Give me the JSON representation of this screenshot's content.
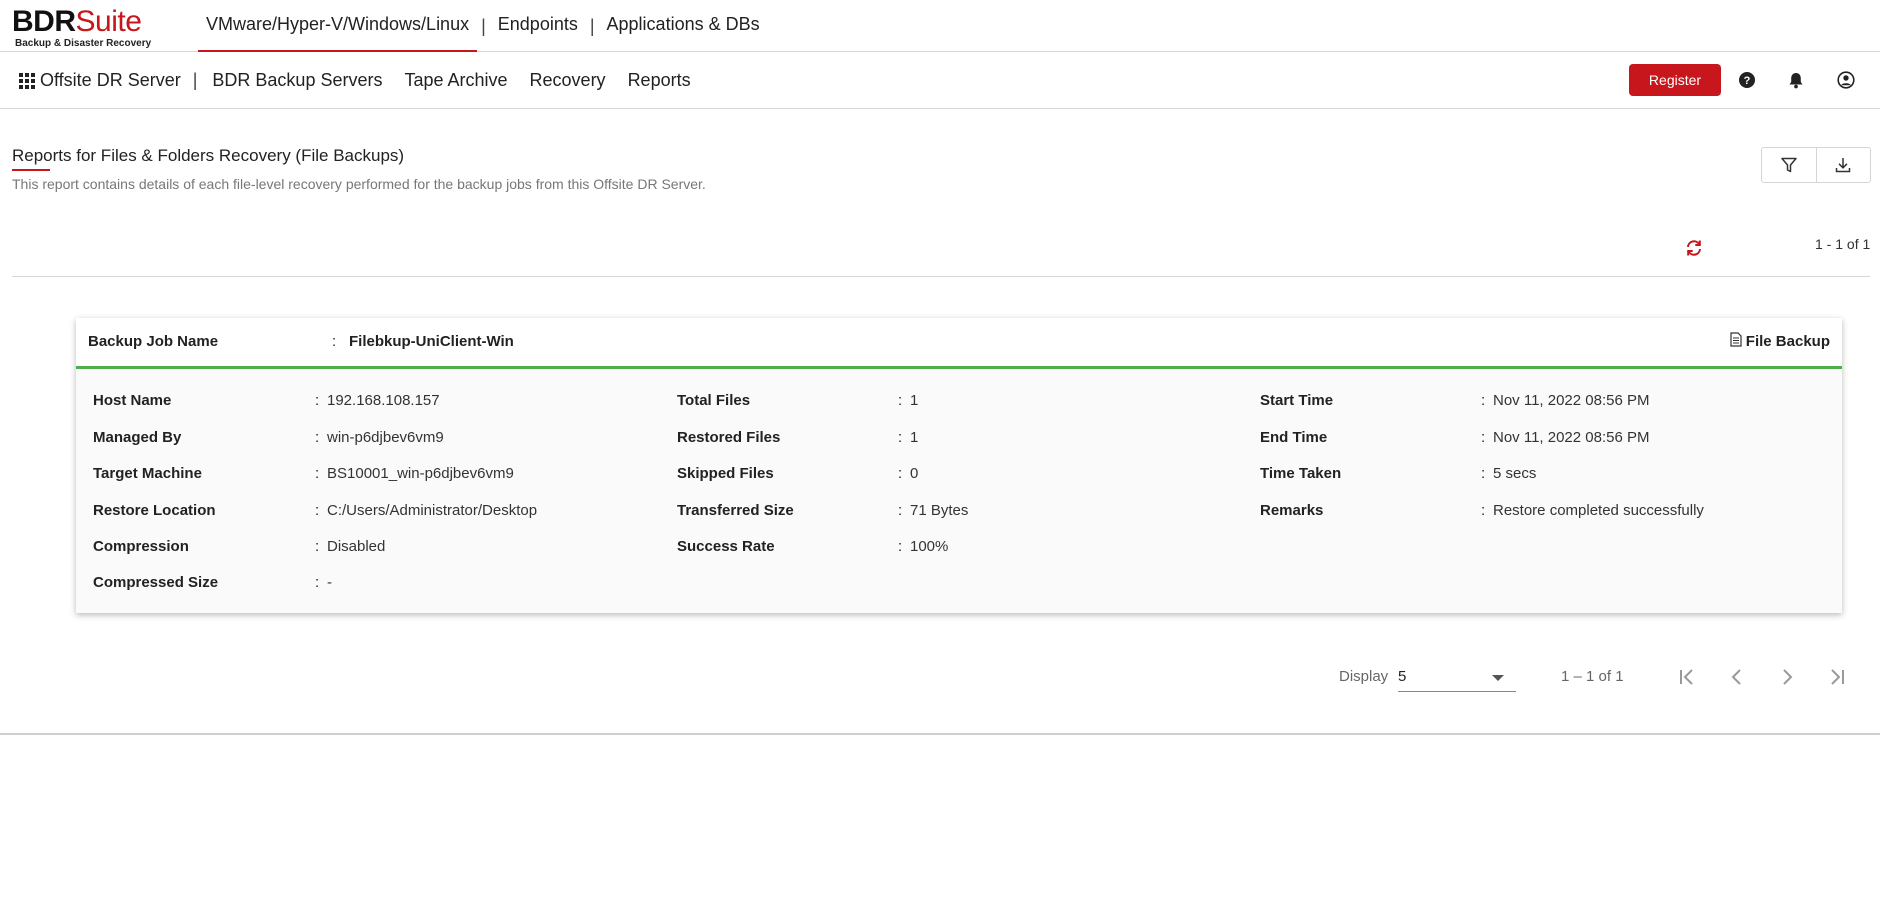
{
  "logo": {
    "brand_part1": "BDR",
    "brand_part2": "Suite",
    "tagline": "Backup & Disaster Recovery"
  },
  "top_nav": {
    "items": [
      {
        "label": "VMware/Hyper-V/Windows/Linux",
        "active": true
      },
      {
        "label": "Endpoints",
        "active": false
      },
      {
        "label": "Applications & DBs",
        "active": false
      }
    ],
    "separator": "|"
  },
  "sub_nav": {
    "server_label": "Offsite DR Server",
    "separator": "|",
    "items": [
      "BDR Backup Servers",
      "Tape Archive",
      "Recovery",
      "Reports"
    ]
  },
  "header_actions": {
    "register_label": "Register",
    "icons": [
      "help-icon",
      "bell-icon",
      "user-icon"
    ]
  },
  "page": {
    "title": "Reports for Files & Folders Recovery (File Backups)",
    "subtitle": "This report contains details of each file-level recovery performed for the backup jobs from this Offsite DR Server.",
    "tools": [
      "filter-icon",
      "download-icon"
    ],
    "count": "1 - 1 of 1"
  },
  "colors": {
    "accent": "#c8161d",
    "success": "#4cae4c",
    "divider": "#d7d7d7"
  },
  "card": {
    "job_label": "Backup Job Name",
    "colon": ":",
    "job_name": "Filebkup-UniClient-Win",
    "job_type": "File Backup",
    "columns": [
      [
        {
          "label": "Host Name",
          "value": "192.168.108.157"
        },
        {
          "label": "Managed By",
          "value": "win-p6djbev6vm9"
        },
        {
          "label": "Target Machine",
          "value": "BS10001_win-p6djbev6vm9"
        },
        {
          "label": "Restore Location",
          "value": "C:/Users/Administrator/Desktop"
        },
        {
          "label": "Compression",
          "value": "Disabled"
        },
        {
          "label": "Compressed Size",
          "value": "-"
        }
      ],
      [
        {
          "label": "Total Files",
          "value": "1"
        },
        {
          "label": "Restored Files",
          "value": "1"
        },
        {
          "label": "Skipped Files",
          "value": "0"
        },
        {
          "label": "Transferred Size",
          "value": "71 Bytes"
        },
        {
          "label": "Success Rate",
          "value": "100%"
        }
      ],
      [
        {
          "label": "Start Time",
          "value": "Nov 11, 2022 08:56 PM"
        },
        {
          "label": "End Time",
          "value": "Nov 11, 2022 08:56 PM"
        },
        {
          "label": "Time Taken",
          "value": "5 secs"
        },
        {
          "label": "Remarks",
          "value": "Restore completed successfully"
        }
      ]
    ]
  },
  "pagination": {
    "display_label": "Display",
    "page_size": "5",
    "range": "1 – 1 of 1",
    "buttons": [
      "first-page-icon",
      "previous-page-icon",
      "next-page-icon",
      "last-page-icon"
    ]
  }
}
